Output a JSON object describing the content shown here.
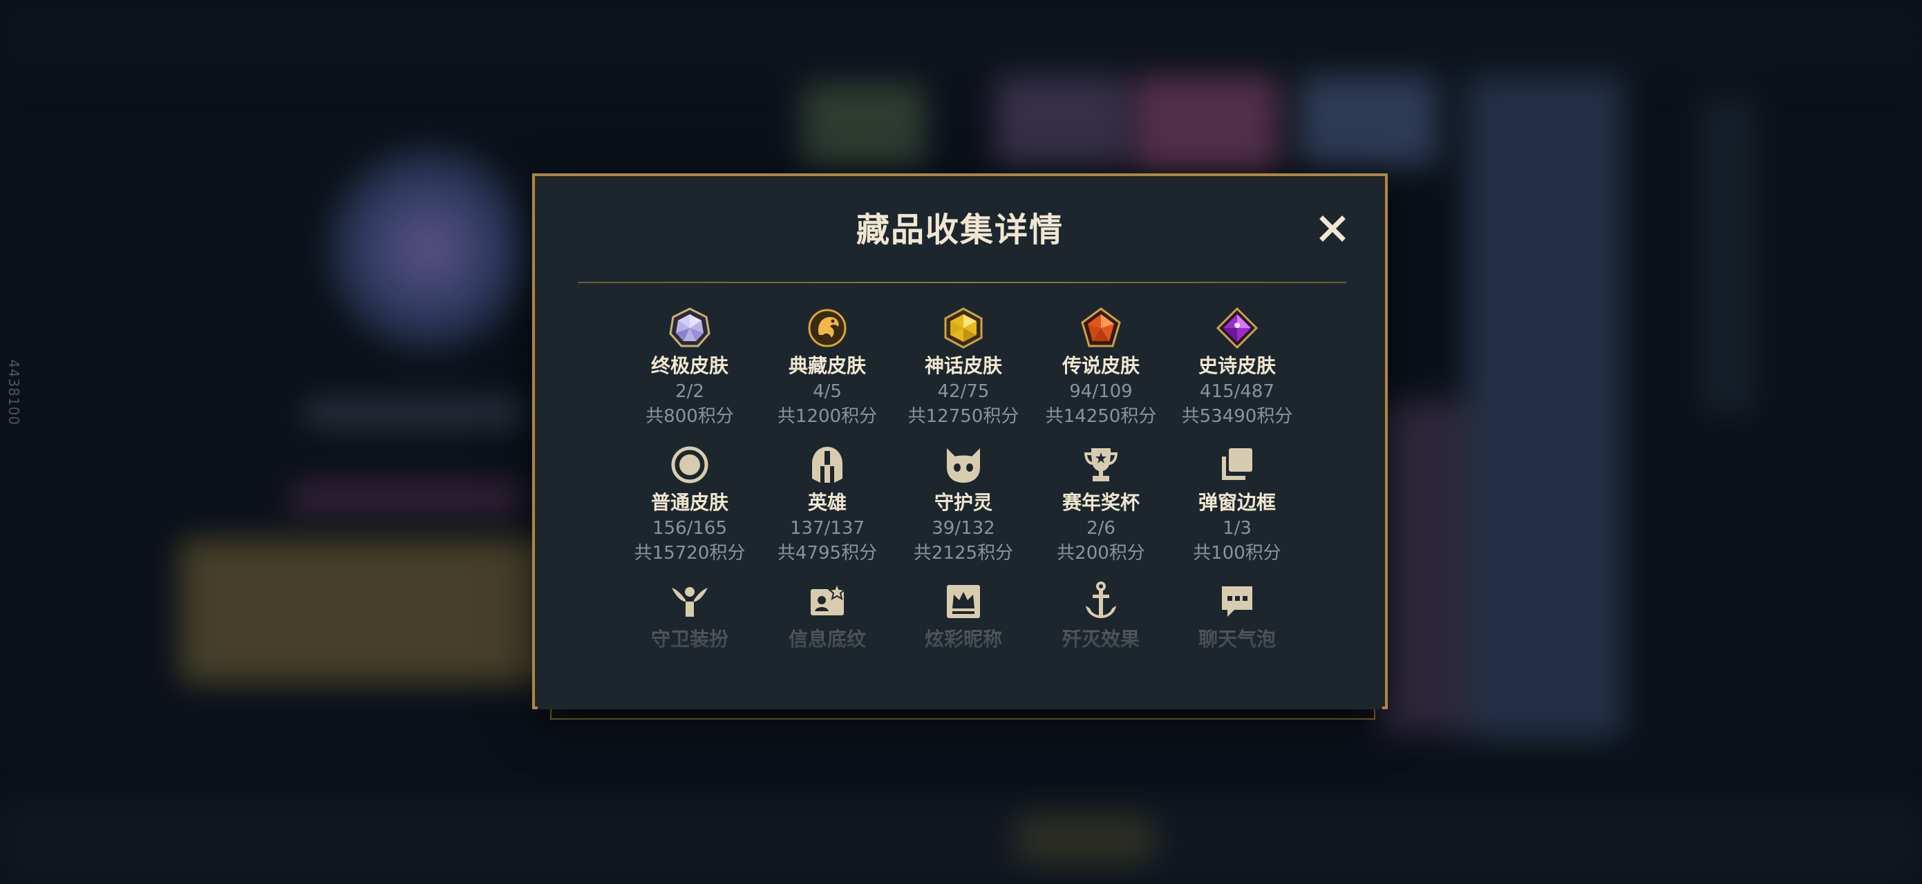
{
  "background": {
    "side_code": "4438100"
  },
  "dialog": {
    "title": "藏品收集详情",
    "close_icon": "close-icon"
  },
  "rows": [
    [
      {
        "icon": "ultimate-gem-icon",
        "label": "终极皮肤",
        "progress": "2/2",
        "points": "共800积分"
      },
      {
        "icon": "dragon-emblem-icon",
        "label": "典藏皮肤",
        "progress": "4/5",
        "points": "共1200积分"
      },
      {
        "icon": "mythic-gem-icon",
        "label": "神话皮肤",
        "progress": "42/75",
        "points": "共12750积分"
      },
      {
        "icon": "legendary-gem-icon",
        "label": "传说皮肤",
        "progress": "94/109",
        "points": "共14250积分"
      },
      {
        "icon": "epic-gem-icon",
        "label": "史诗皮肤",
        "progress": "415/487",
        "points": "共53490积分"
      }
    ],
    [
      {
        "icon": "standard-skin-icon",
        "label": "普通皮肤",
        "progress": "156/165",
        "points": "共15720积分"
      },
      {
        "icon": "champion-helmet-icon",
        "label": "英雄",
        "progress": "137/137",
        "points": "共4795积分"
      },
      {
        "icon": "little-legend-icon",
        "label": "守护灵",
        "progress": "39/132",
        "points": "共2125积分"
      },
      {
        "icon": "trophy-icon",
        "label": "赛年奖杯",
        "progress": "2/6",
        "points": "共200积分"
      },
      {
        "icon": "popup-frame-icon",
        "label": "弹窗边框",
        "progress": "1/3",
        "points": "共100积分"
      }
    ],
    [
      {
        "icon": "guardian-outfit-icon",
        "label": "守卫装扮"
      },
      {
        "icon": "info-card-icon",
        "label": "信息底纹"
      },
      {
        "icon": "crown-nickname-icon",
        "label": "炫彩昵称"
      },
      {
        "icon": "anchor-effect-icon",
        "label": "歼灭效果"
      },
      {
        "icon": "chat-bubble-icon",
        "label": "聊天气泡"
      }
    ]
  ],
  "colors": {
    "gold_border": "#a9874d",
    "title_text": "#f0e6d2",
    "muted_text": "#8c939b",
    "panel_bg": "#1d262c"
  }
}
